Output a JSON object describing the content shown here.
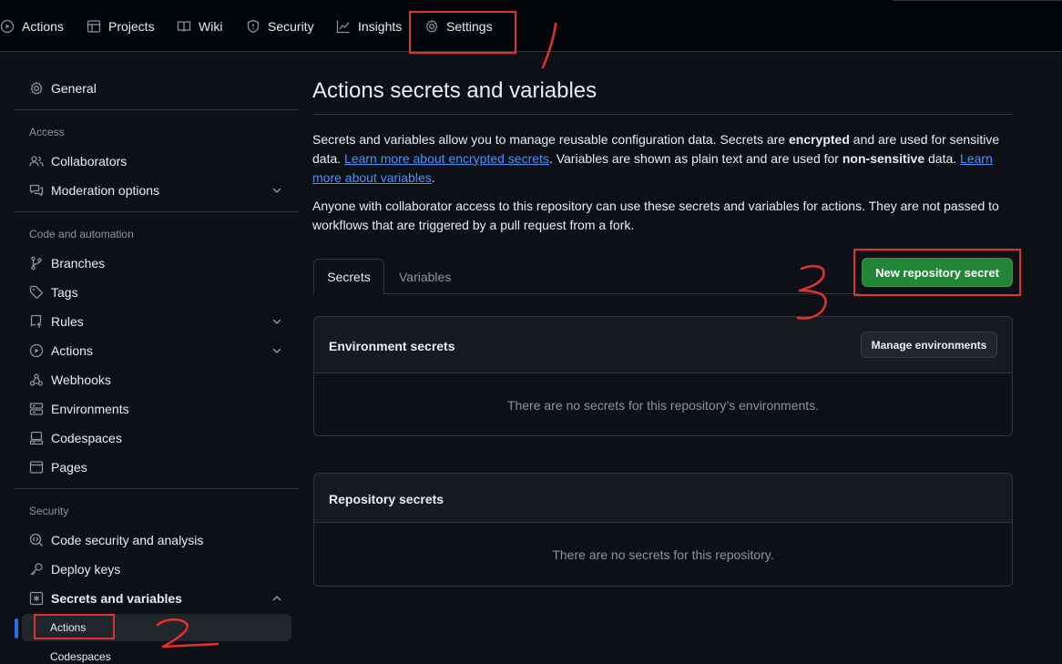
{
  "topnav": {
    "tabs": [
      {
        "label": "Actions",
        "icon": "play-icon"
      },
      {
        "label": "Projects",
        "icon": "table-icon"
      },
      {
        "label": "Wiki",
        "icon": "book-icon"
      },
      {
        "label": "Security",
        "icon": "shield-icon"
      },
      {
        "label": "Insights",
        "icon": "graph-icon"
      },
      {
        "label": "Settings",
        "icon": "gear-icon"
      }
    ]
  },
  "sidebar": {
    "general": "General",
    "access_heading": "Access",
    "collaborators": "Collaborators",
    "moderation": "Moderation options",
    "code_heading": "Code and automation",
    "branches": "Branches",
    "tags": "Tags",
    "rules": "Rules",
    "actions": "Actions",
    "webhooks": "Webhooks",
    "environments": "Environments",
    "codespaces": "Codespaces",
    "pages": "Pages",
    "security_heading": "Security",
    "code_security": "Code security and analysis",
    "deploy_keys": "Deploy keys",
    "secrets_vars": "Secrets and variables",
    "sub_actions": "Actions",
    "sub_codespaces": "Codespaces"
  },
  "main": {
    "title": "Actions secrets and variables",
    "para1_a": "Secrets and variables allow you to manage reusable configuration data. Secrets are ",
    "para1_b": "encrypted",
    "para1_c": " and are used for sensitive data. ",
    "para1_link1": "Learn more about encrypted secrets",
    "para1_d": ". Variables are shown as plain text and are used for ",
    "para1_e": "non-sensitive",
    "para1_f": " data. ",
    "para1_link2": "Learn more about variables",
    "para1_g": ".",
    "para2": "Anyone with collaborator access to this repository can use these secrets and variables for actions. They are not passed to workflows that are triggered by a pull request from a fork.",
    "tab_secrets": "Secrets",
    "tab_variables": "Variables",
    "new_secret_button": "New repository secret",
    "env_title": "Environment secrets",
    "manage_env_button": "Manage environments",
    "env_empty": "There are no secrets for this repository’s environments.",
    "repo_title": "Repository secrets",
    "repo_empty": "There are no secrets for this repository."
  },
  "colors": {
    "annotation": "#e5302f",
    "accent_green": "#238636",
    "link": "#4493f8",
    "background": "#0d1117"
  }
}
